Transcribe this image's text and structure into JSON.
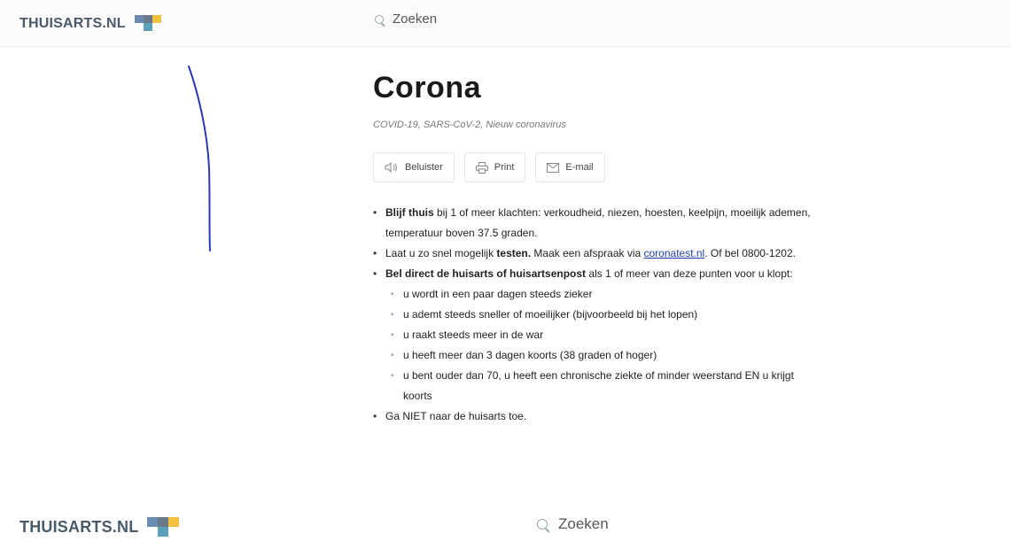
{
  "header": {
    "logo_text": "THUISARTS.NL",
    "search_label": "Zoeken"
  },
  "footer_header": {
    "logo_text": "THUISARTS.NL",
    "search_label": "Zoeken"
  },
  "brand_colors": {
    "blue": "#6c8bb0",
    "gray": "#6b7a8a",
    "yellow": "#f2c140",
    "teal": "#5aa0b8",
    "link": "#1a3fa6",
    "annotation_stroke": "#2b38b8"
  },
  "article": {
    "title": "Corona",
    "subtitle": "COVID-19, SARS-CoV-2, Nieuw coronavirus",
    "actions": [
      {
        "label": "Beluister",
        "icon": "speaker-icon"
      },
      {
        "label": "Print",
        "icon": "printer-icon"
      },
      {
        "label": "E-mail",
        "icon": "envelope-icon"
      }
    ],
    "bullets": {
      "b1_bold": "Blijf thuis",
      "b1_text": " bij 1 of meer klachten: verkoudheid, niezen, hoesten, keelpijn, moeilijk ademen, temperatuur boven 37.5 graden.",
      "b2_pre": "Laat u zo snel mogelijk ",
      "b2_bold": "testen.",
      "b2_mid": " Maak een afspraak via ",
      "b2_link": "coronatest.nl",
      "b2_post": ". Of bel 0800-1202.",
      "b3_bold": "Bel direct de huisarts of huisartsenpost",
      "b3_text": " als 1 of meer van deze punten voor u klopt:",
      "sub": [
        "u wordt in een paar dagen steeds zieker",
        "u ademt steeds sneller of moeilijker (bijvoorbeeld bij het lopen)",
        "u raakt steeds meer in de war",
        "u heeft meer dan 3 dagen koorts (38 graden of hoger)",
        "u bent ouder dan 70, u heeft een chronische ziekte of minder weerstand EN u krijgt koorts"
      ],
      "b4_text": "Ga NIET naar de huisarts toe."
    }
  }
}
